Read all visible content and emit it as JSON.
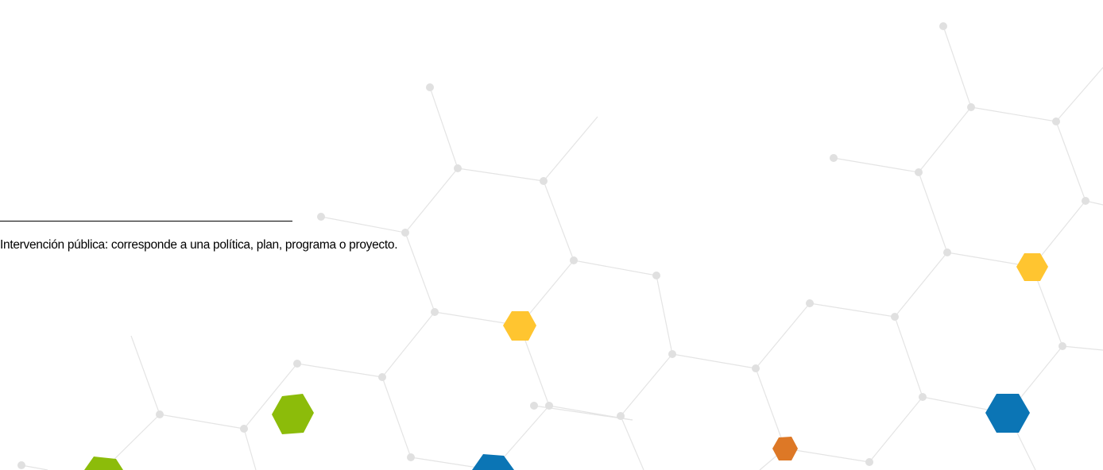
{
  "footnote": {
    "text": "Intervención pública: corresponde a una política, plan, programa o proyecto."
  },
  "decoration": {
    "line_color": "#e4e4e4",
    "node_color": "#e0e0e0",
    "hexagon_colors": {
      "green": "#8cbc0a",
      "yellow": "#ffc530",
      "blue": "#0b75b5",
      "orange": "#dd7826"
    }
  }
}
